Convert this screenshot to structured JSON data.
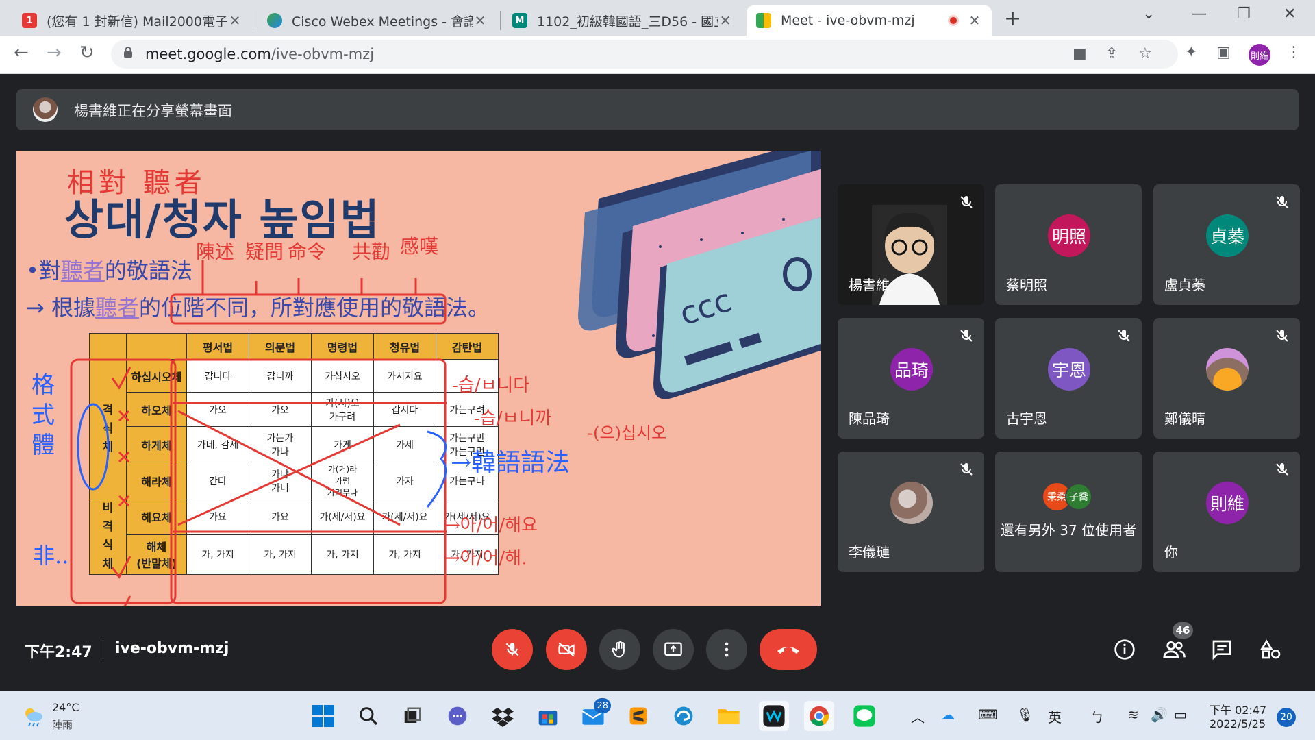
{
  "browser": {
    "tabs": [
      {
        "title": "(您有 1 封新信) Mail2000電子信",
        "favicon_color": "#e53935",
        "active": false
      },
      {
        "title": "Cisco Webex Meetings - 會議詳",
        "favicon_color": "#1e88e5",
        "active": false
      },
      {
        "title": "1102_初級韓國語_三D56 - 國立",
        "favicon_color": "#00897b",
        "active": false
      },
      {
        "title": "Meet - ive-obvm-mzj",
        "favicon_color": "#fbbc04",
        "active": true
      }
    ],
    "url_host": "meet.google.com",
    "url_path": "/ive-obvm-mzj",
    "profile_initials": "則維"
  },
  "meet": {
    "share_banner": "楊書維正在分享螢幕畫面",
    "time": "下午2:47",
    "meeting_code": "ive-obvm-mzj",
    "participants_count": "46",
    "participants": [
      {
        "name": "楊書維",
        "initial": "",
        "avatar_color": "",
        "muted": true,
        "video": true
      },
      {
        "name": "蔡明照",
        "initial": "明照",
        "avatar_color": "#c2185b",
        "muted": false,
        "video": false
      },
      {
        "name": "盧貞蓁",
        "initial": "貞蓁",
        "avatar_color": "#00897b",
        "muted": true,
        "video": false
      },
      {
        "name": "陳品琦",
        "initial": "品琦",
        "avatar_color": "#8e24aa",
        "muted": true,
        "video": false
      },
      {
        "name": "古宇恩",
        "initial": "宇恩",
        "avatar_color": "#7e57c2",
        "muted": true,
        "video": false
      },
      {
        "name": "鄭儀晴",
        "initial": "",
        "avatar_color": "",
        "muted": true,
        "video": false
      },
      {
        "name": "李儀璉",
        "initial": "",
        "avatar_color": "",
        "muted": true,
        "video": false
      },
      {
        "name": "還有另外 37 位使用者",
        "initial": "",
        "avatar_color": "",
        "muted": false,
        "video": false
      },
      {
        "name": "你",
        "initial": "則維",
        "avatar_color": "#8e24aa",
        "muted": true,
        "video": false
      }
    ],
    "others_avatars": [
      "秉柔",
      "子喬"
    ]
  },
  "slide": {
    "title_cn": "相對 聽者",
    "title_ko": "상대/청자 높임법",
    "bullet1_prefix": "•對",
    "bullet1_hl": "聽者",
    "bullet1_suffix": "的敬語法",
    "bullet2_prefix": "→ 根據",
    "bullet2_hl": "聽者",
    "bullet2_suffix": "的位階不同，所對應使用的敬語法。",
    "card_text": "ccc",
    "table": {
      "headers": [
        "평서법",
        "의문법",
        "명령법",
        "청유법",
        "감탄법"
      ],
      "side_formal": "격\n식\n체",
      "side_informal": "비\n격\n식\n체",
      "rows": [
        {
          "name": "하십시오체",
          "cells": [
            "갑니다",
            "갑니까",
            "가십시오",
            "가시지요",
            "-"
          ]
        },
        {
          "name": "하오체",
          "cells": [
            "가오",
            "가오",
            "가(시)오\n가구려",
            "갑시다",
            "가는구려"
          ]
        },
        {
          "name": "하게체",
          "cells": [
            "가네, 감세",
            "가는가\n가나",
            "가게",
            "가세",
            "가는구만\n가는구먼"
          ]
        },
        {
          "name": "해라체",
          "cells": [
            "간다",
            "가냐\n가니",
            "가(거)라\n가렴\n가려무나",
            "가자",
            "가는구나"
          ]
        },
        {
          "name": "해요체",
          "cells": [
            "가요",
            "가요",
            "가(세/서)요",
            "가(세/서)요",
            "가(세/서)요"
          ]
        },
        {
          "name": "해체\n(반말체)",
          "cells": [
            "가, 가지",
            "가, 가지",
            "가, 가지",
            "가, 가지",
            "가, 가지"
          ]
        }
      ]
    },
    "annotations": {
      "top_labels": [
        "陳述",
        "疑問",
        "命令",
        "共勸",
        "感嘆"
      ],
      "right1": "-습/ㅂ니다",
      "right2": "-습/ㅂ니까",
      "right3": "-(으)십시오",
      "right_blue": "→韓語語法",
      "right4": "→아/어/해요",
      "right5": "→아/어/해.",
      "left_vertical": "格\n式\n體",
      "left_non": "非.."
    }
  },
  "taskbar": {
    "weather_temp": "24°C",
    "weather_desc": "陣雨",
    "mail_badge": "28",
    "ime_lang": "英",
    "ime_mode": "ㄅ",
    "clock_time": "下午 02:47",
    "clock_date": "2022/5/25",
    "notifications": "20"
  }
}
